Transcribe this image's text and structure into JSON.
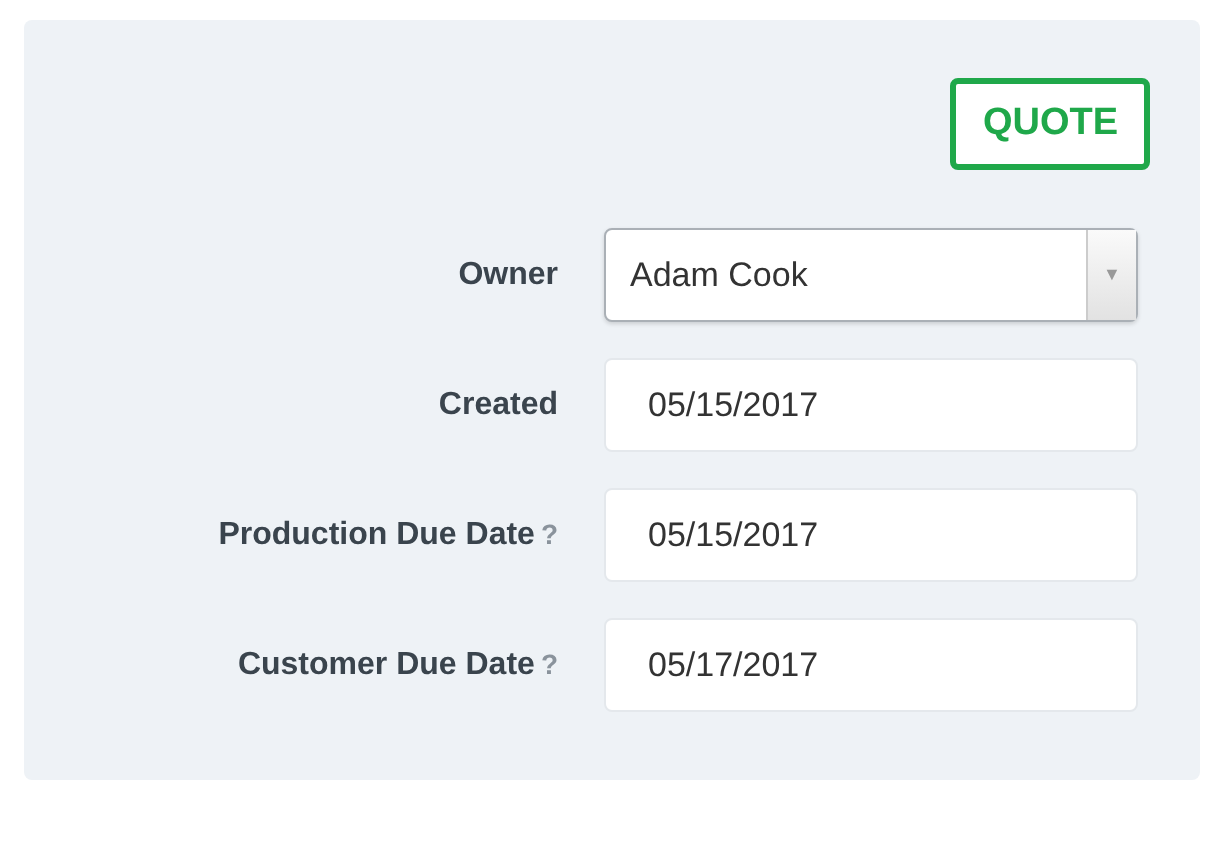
{
  "status_button": {
    "label": "QUOTE"
  },
  "fields": [
    {
      "kind": "select",
      "label": "Owner",
      "value": "Adam Cook",
      "caret": "▼"
    },
    {
      "kind": "text",
      "label": "Created",
      "value": "05/15/2017"
    },
    {
      "kind": "text",
      "label": "Production Due Date",
      "help": "?",
      "value": "05/15/2017"
    },
    {
      "kind": "text",
      "label": "Customer Due Date",
      "help": "?",
      "value": "05/17/2017"
    }
  ]
}
